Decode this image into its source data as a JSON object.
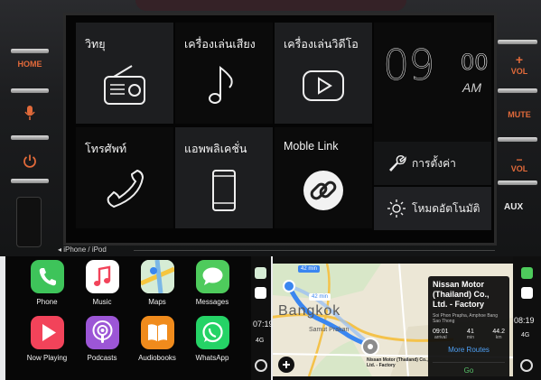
{
  "head_unit": {
    "left_buttons": {
      "home": "HOME"
    },
    "right_buttons": {
      "vol_up": "VOL",
      "mute": "MUTE",
      "vol_down": "VOL",
      "aux": "AUX"
    }
  },
  "menu": {
    "radio": "วิทยุ",
    "music_player": "เครื่องเล่นเสียง",
    "video_player": "เครื่องเล่นวิดีโอ",
    "phone": "โทรศัพท์",
    "apps": "แอพพลิเคชั่น",
    "mobile_link": "Moble Link",
    "settings": "การตั้งค่า",
    "auto_mode": "โหมดอัตโนมัติ"
  },
  "clock": {
    "hour": "09",
    "minute": "00",
    "ampm": "AM"
  },
  "source_label": "◂ iPhone / iPod",
  "carplay_apps": [
    {
      "name": "Phone",
      "icon": "phone-icon",
      "color": "#3ec45a"
    },
    {
      "name": "Music",
      "icon": "music-icon",
      "color": "#ffffff"
    },
    {
      "name": "Maps",
      "icon": "maps-icon",
      "color": "#7bc3e8"
    },
    {
      "name": "Messages",
      "icon": "messages-icon",
      "color": "#4ecb5c"
    },
    {
      "name": "Now Playing",
      "icon": "now-playing-icon",
      "color": "#f2435a"
    },
    {
      "name": "Podcasts",
      "icon": "podcasts-icon",
      "color": "#9c56d6"
    },
    {
      "name": "Audiobooks",
      "icon": "audiobooks-icon",
      "color": "#f08b1c"
    },
    {
      "name": "WhatsApp",
      "icon": "whatsapp-icon",
      "color": "#25d366"
    }
  ],
  "status_left": {
    "time": "07:19",
    "network": "4G"
  },
  "status_right": {
    "time": "08:19",
    "network": "4G"
  },
  "map": {
    "city_label": "Bangkok",
    "district_label": "Samut Prakan",
    "eta_bubble": "42 min",
    "eta_bubble_2": "42 min",
    "pin_label": "Nissan Motor (Thailand) Co., Ltd. - Factory",
    "card": {
      "title": "Nissan Motor (Thailand) Co., Ltd. - Factory",
      "address": "Soi Phon Prapha, Amphoe Bang Sao Thong",
      "arrival": "09:01",
      "arrival_unit": "arrival",
      "duration": "41",
      "duration_unit": "min",
      "distance": "44.2",
      "distance_unit": "km",
      "more_routes": "More Routes",
      "go": "Go"
    }
  }
}
